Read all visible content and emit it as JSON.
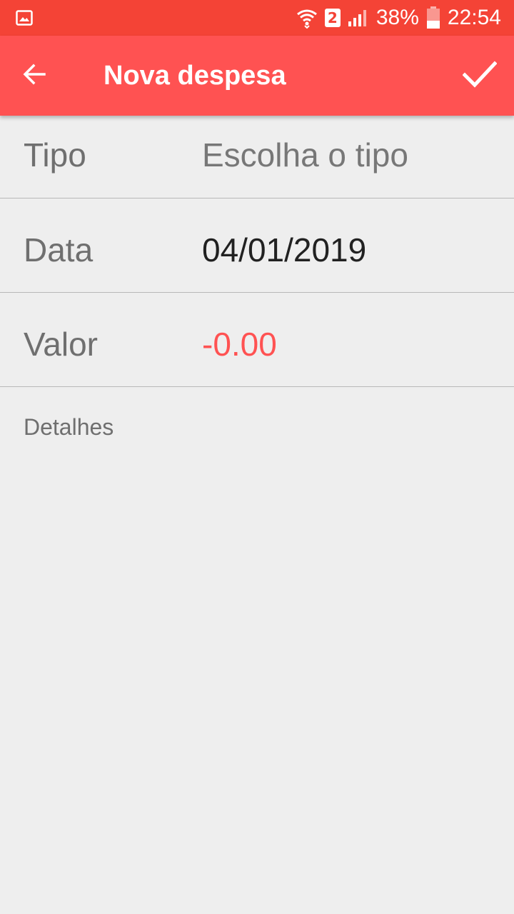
{
  "status_bar": {
    "notification_icon": "image-icon",
    "wifi_icon": "wifi-icon",
    "sim_label": "2",
    "signal_icon": "signal-icon",
    "battery_percent": "38%",
    "battery_icon": "battery-icon",
    "time": "22:54",
    "color": "#f44336"
  },
  "app_bar": {
    "back_icon": "arrow-back-icon",
    "title": "Nova despesa",
    "confirm_icon": "check-icon",
    "color": "#ff5252"
  },
  "form": {
    "tipo": {
      "label": "Tipo",
      "value": "Escolha o tipo"
    },
    "data": {
      "label": "Data",
      "value": "04/01/2019"
    },
    "valor": {
      "label": "Valor",
      "value": "-0.00",
      "color": "#ff5252"
    },
    "details_label": "Detalhes"
  }
}
